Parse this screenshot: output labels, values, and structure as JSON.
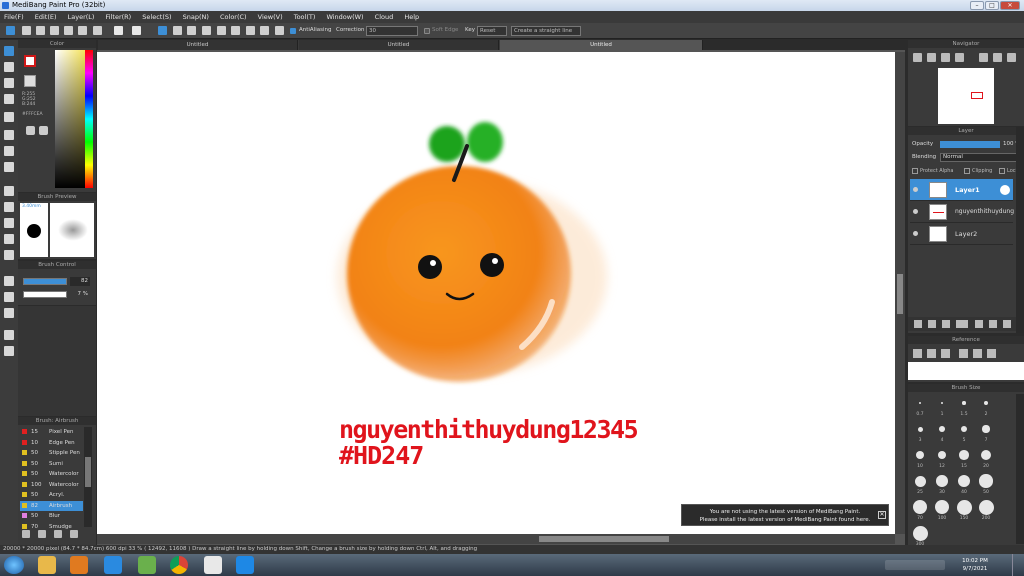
{
  "window": {
    "title": "MediBang Paint Pro (32bit)",
    "controls": [
      "–",
      "□",
      "✕"
    ]
  },
  "menu": [
    "File(F)",
    "Edit(E)",
    "Layer(L)",
    "Filter(R)",
    "Select(S)",
    "Snap(N)",
    "Color(C)",
    "View(V)",
    "Tool(T)",
    "Window(W)",
    "Cloud",
    "Help"
  ],
  "toolbar": {
    "antialiasing": "AntiAliasing",
    "correction_label": "Correction",
    "correction_value": "30",
    "soft_edge": "Soft Edge",
    "key_label": "Key",
    "reset": "Reset",
    "straight_line": "Create a straight line"
  },
  "tabs": [
    "Untitled",
    "Untitled",
    "Untitled"
  ],
  "color_panel": {
    "title": "Color",
    "r": "R:255",
    "g": "G:252",
    "b": "B:244",
    "hex": "#FFFCEA"
  },
  "brush_preview": {
    "title": "Brush Preview",
    "size": "3.40mm"
  },
  "brush_control": {
    "title": "Brush Control",
    "size": "82",
    "opacity": "7 %"
  },
  "brush_list": {
    "title": "Brush: Airbrush",
    "items": [
      {
        "num": "15",
        "name": "Pixel Pen",
        "color": "#e02020"
      },
      {
        "num": "10",
        "name": "Edge Pen",
        "color": "#e02020"
      },
      {
        "num": "50",
        "name": "Stipple Pen",
        "color": "#e0c020"
      },
      {
        "num": "50",
        "name": "Sumi",
        "color": "#e0c020"
      },
      {
        "num": "50",
        "name": "Watercolor",
        "color": "#e0c020"
      },
      {
        "num": "100",
        "name": "Watercolor",
        "color": "#e0c020"
      },
      {
        "num": "50",
        "name": "Acryl.",
        "color": "#e0c020"
      },
      {
        "num": "82",
        "name": "Airbrush",
        "color": "#e0c020"
      },
      {
        "num": "50",
        "name": "Blur",
        "color": "#e080e0"
      },
      {
        "num": "70",
        "name": "Smudge",
        "color": "#e0c020"
      }
    ]
  },
  "canvas": {
    "text1": "nguyenthithuydung12345",
    "text2": "#HD247",
    "text_color": "#e0141c",
    "notice_line1": "You are not using the latest version of MediBang Paint.",
    "notice_line2": "Please install the latest version of MediBang Paint found here."
  },
  "navigator": {
    "title": "Navigator"
  },
  "layer_panel": {
    "title": "Layer",
    "opacity_label": "Opacity",
    "opacity_value": "100 %",
    "blending_label": "Blending",
    "blending_value": "Normal",
    "protect_alpha": "Protect Alpha",
    "clipping": "Clipping",
    "lock": "Lock",
    "layers": [
      {
        "name": "Layer1",
        "selected": true
      },
      {
        "name": "nguyenthithuydung",
        "selected": false
      },
      {
        "name": "Layer2",
        "selected": false
      }
    ]
  },
  "reference": {
    "title": "Reference"
  },
  "brush_size": {
    "title": "Brush Size",
    "labels": [
      "0.7",
      "1",
      "1.5",
      "2",
      "3",
      "4",
      "5",
      "7",
      "10",
      "12",
      "15",
      "20",
      "25",
      "30",
      "40",
      "50",
      "70",
      "100",
      "150",
      "200",
      "300"
    ]
  },
  "status": "20000 * 20000 pixel  (84.7 * 84.7cm)  600 dpi  33 %  ( 12492, 11608 )  Draw a straight line by holding down Shift, Change a brush size by holding down Ctrl, Alt, and dragging",
  "clock": {
    "time": "10:02 PM",
    "date": "9/7/2021"
  },
  "colors": {
    "accent": "#3d8fd6",
    "orange": "#f28a1e",
    "leaf": "#2aa52a"
  }
}
